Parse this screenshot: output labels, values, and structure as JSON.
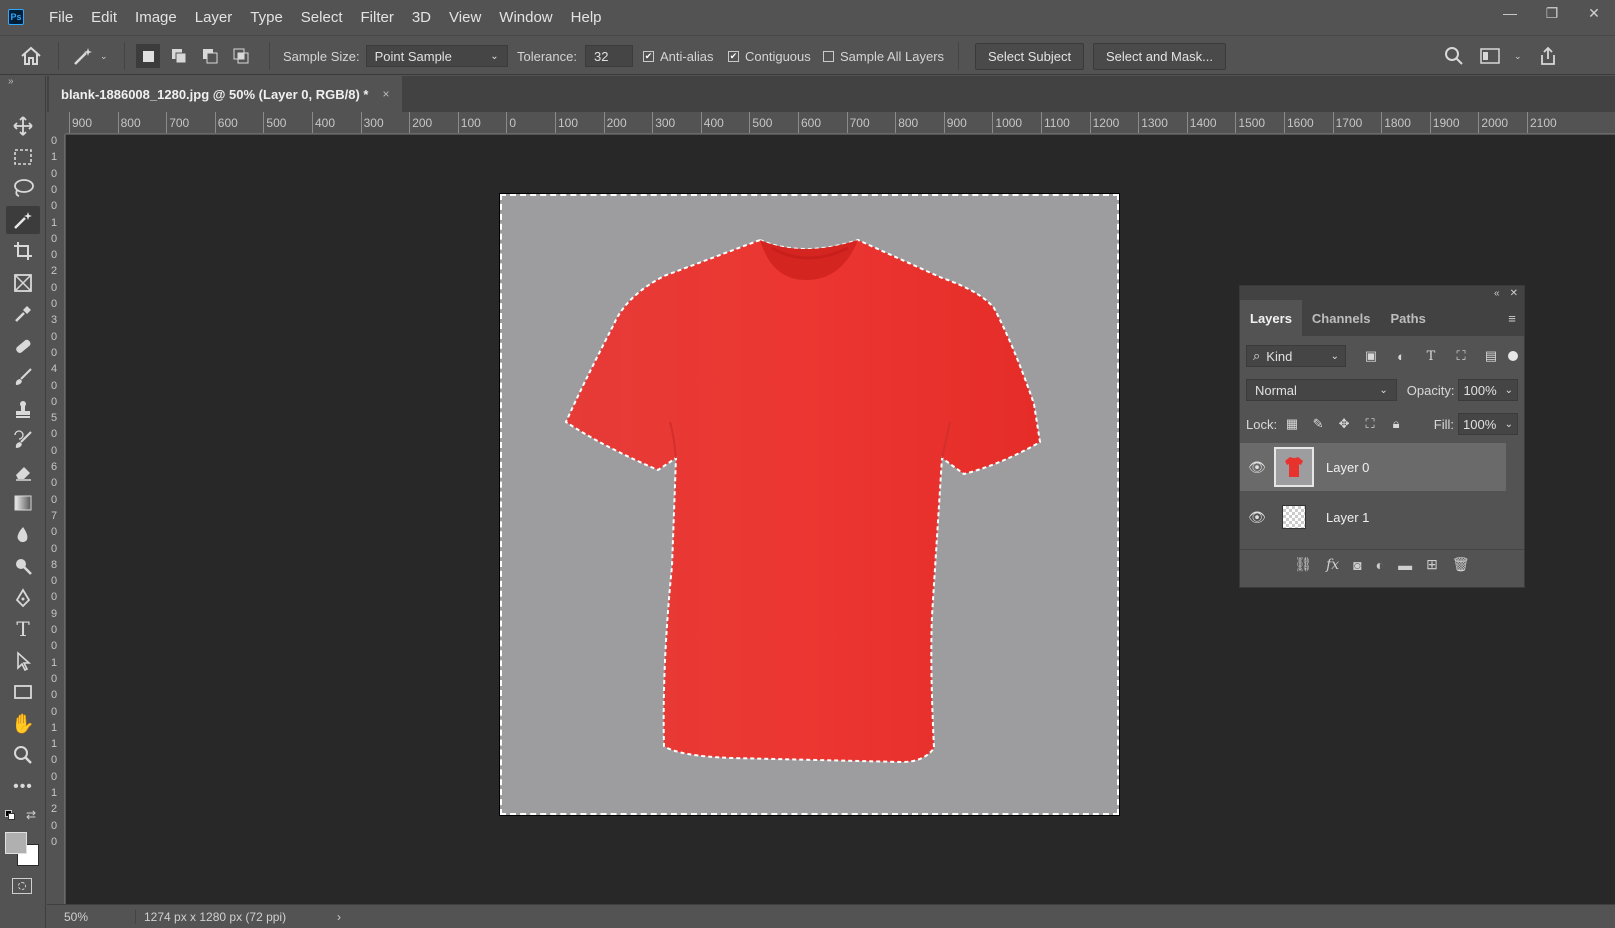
{
  "app": {
    "logo": "Ps"
  },
  "menu": [
    "File",
    "Edit",
    "Image",
    "Layer",
    "Type",
    "Select",
    "Filter",
    "3D",
    "View",
    "Window",
    "Help"
  ],
  "window_controls": {
    "minimize": "—",
    "restore": "❐",
    "close": "✕"
  },
  "options": {
    "sample_size_label": "Sample Size:",
    "sample_size_value": "Point Sample",
    "tolerance_label": "Tolerance:",
    "tolerance_value": "32",
    "anti_alias": {
      "label": "Anti-alias",
      "checked": true
    },
    "contiguous": {
      "label": "Contiguous",
      "checked": true
    },
    "sample_all_layers": {
      "label": "Sample All Layers",
      "checked": false
    },
    "select_subject": "Select Subject",
    "select_and_mask": "Select and Mask..."
  },
  "document": {
    "tab_title": "blank-1886008_1280.jpg @ 50% (Layer 0, RGB/8) *",
    "close": "×"
  },
  "ruler": {
    "h_labels": [
      "900",
      "800",
      "700",
      "600",
      "500",
      "400",
      "300",
      "200",
      "100",
      "0",
      "100",
      "200",
      "300",
      "400",
      "500",
      "600",
      "700",
      "800",
      "900",
      "1000",
      "1100",
      "1200",
      "1300",
      "1400",
      "1500",
      "1600",
      "1700",
      "1800",
      "1900",
      "2000",
      "2100"
    ],
    "v_labels": [
      "0",
      "1",
      "0",
      "0",
      "0",
      "1",
      "0",
      "0",
      "2",
      "0",
      "0",
      "3",
      "0",
      "0",
      "4",
      "0",
      "0",
      "5",
      "0",
      "0",
      "6",
      "0",
      "0",
      "7",
      "0",
      "0",
      "8",
      "0",
      "0",
      "9",
      "0",
      "0",
      "1",
      "0",
      "0",
      "0",
      "1",
      "1",
      "0",
      "0",
      "1",
      "2",
      "0",
      "0"
    ]
  },
  "status": {
    "zoom": "50%",
    "doc_info": "1274 px x 1280 px (72 ppi)",
    "arrow": "›"
  },
  "layers_panel": {
    "tabs": [
      "Layers",
      "Channels",
      "Paths"
    ],
    "active_tab": "Layers",
    "filter_kind": "Kind",
    "blend_mode": "Normal",
    "opacity_label": "Opacity:",
    "opacity_value": "100%",
    "lock_label": "Lock:",
    "fill_label": "Fill:",
    "fill_value": "100%",
    "layers": [
      {
        "name": "Layer 0",
        "visible": true,
        "selected": true
      },
      {
        "name": "Layer 1",
        "visible": true,
        "selected": false
      }
    ]
  },
  "colors": {
    "shirt": "#e8322e",
    "canvas_bg": "#282828",
    "doc_bg": "#9d9d9f"
  }
}
